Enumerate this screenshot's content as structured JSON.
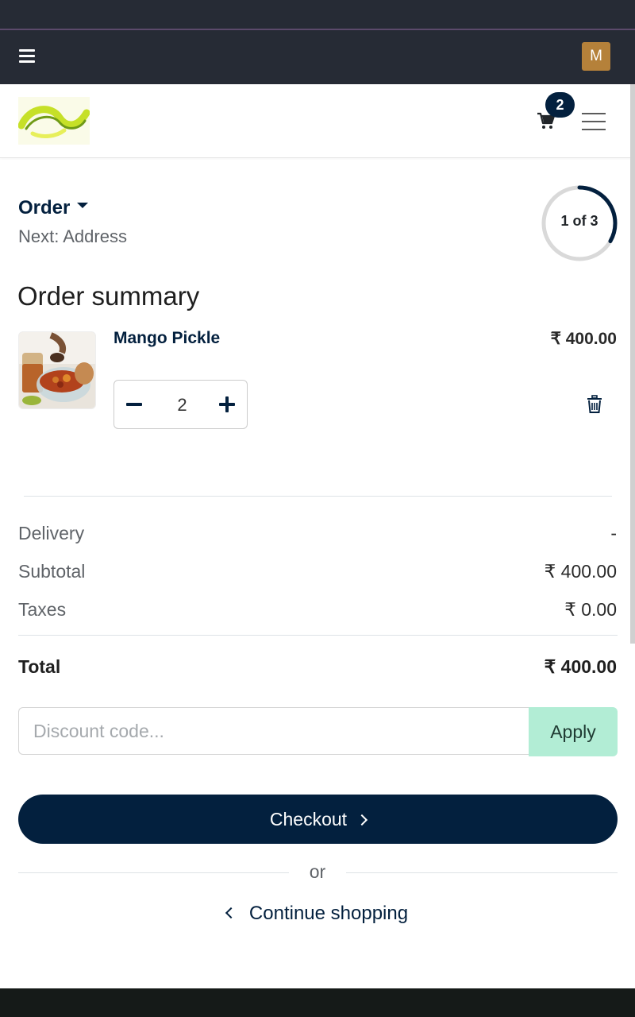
{
  "topbar": {
    "avatar_initial": "M"
  },
  "header": {
    "cart_count": "2"
  },
  "checkout_step": {
    "current": "Order",
    "next": "Next: Address",
    "progress_label": "1 of 3",
    "progress_fraction": 0.333
  },
  "summary": {
    "title": "Order summary",
    "item": {
      "name": "Mango Pickle",
      "price": "₹ 400.00",
      "quantity": "2"
    }
  },
  "totals": {
    "delivery_label": "Delivery",
    "delivery_value": "-",
    "subtotal_label": "Subtotal",
    "subtotal_value": "₹ 400.00",
    "taxes_label": "Taxes",
    "taxes_value": "₹ 0.00",
    "total_label": "Total",
    "total_value": "₹ 400.00"
  },
  "discount": {
    "placeholder": "Discount code...",
    "apply_label": "Apply"
  },
  "actions": {
    "checkout_label": "Checkout",
    "or_text": "or",
    "continue_label": "Continue shopping"
  },
  "colors": {
    "primary": "#03203e",
    "topbar": "#262b35",
    "avatar": "#b5813a",
    "apply_bg": "#b2edd5"
  }
}
